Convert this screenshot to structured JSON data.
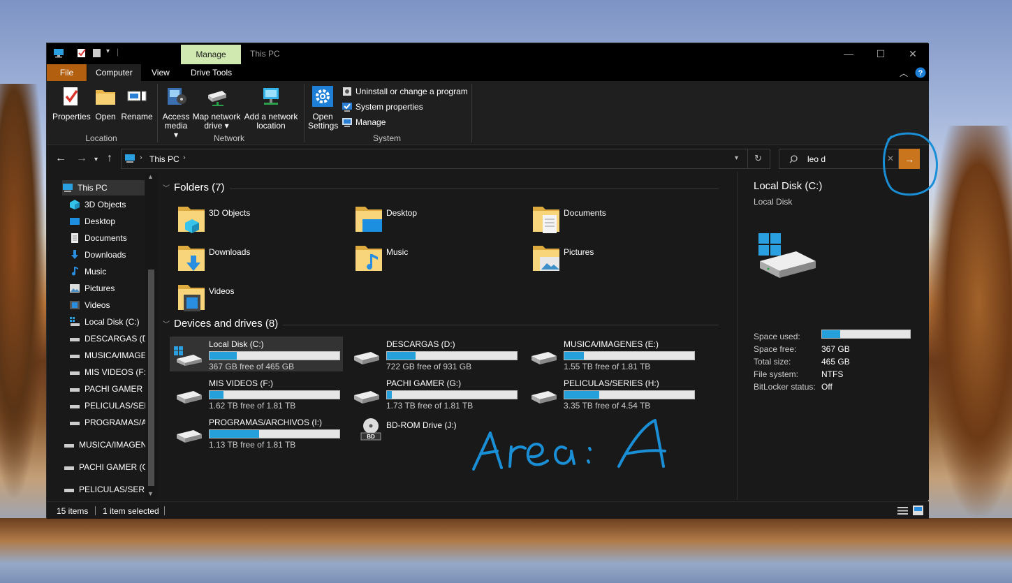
{
  "window": {
    "manage_tab": "Manage",
    "title": "This PC"
  },
  "ribbon_tabs": [
    "File",
    "Computer",
    "View",
    "Drive Tools"
  ],
  "ribbon": {
    "location": {
      "label": "Location",
      "buttons": [
        "Properties",
        "Open",
        "Rename"
      ]
    },
    "network": {
      "label": "Network",
      "access_media": [
        "Access",
        "media"
      ],
      "map_drive": [
        "Map network",
        "drive"
      ],
      "add_location": [
        "Add a network",
        "location"
      ]
    },
    "system": {
      "label": "System",
      "open_settings": [
        "Open",
        "Settings"
      ],
      "uninstall": "Uninstall or change a program",
      "system_properties": "System properties",
      "manage": "Manage"
    }
  },
  "address": {
    "path": "This PC",
    "search_value": "leo d"
  },
  "sidebar": {
    "items": [
      "This PC",
      "3D Objects",
      "Desktop",
      "Documents",
      "Downloads",
      "Music",
      "Pictures",
      "Videos",
      "Local Disk (C:)",
      "DESCARGAS (D:)",
      "MUSICA/IMAGE",
      "MIS VIDEOS (F:)",
      "PACHI GAMER (",
      "PELICULAS/SERI",
      "PROGRAMAS/AI",
      "MUSICA/IMAGEN",
      "PACHI GAMER (G:",
      "PELICULAS/SERIES"
    ]
  },
  "folders": {
    "header": "Folders (7)",
    "items": [
      "3D Objects",
      "Desktop",
      "Documents",
      "Downloads",
      "Music",
      "Pictures",
      "Videos"
    ]
  },
  "drives": {
    "header": "Devices and drives (8)",
    "items": [
      {
        "name": "Local Disk (C:)",
        "free": "367 GB free of 465 GB",
        "used_fraction": 0.21
      },
      {
        "name": "DESCARGAS (D:)",
        "free": "722 GB free of 931 GB",
        "used_fraction": 0.22
      },
      {
        "name": "MUSICA/IMAGENES (E:)",
        "free": "1.55 TB free of 1.81 TB",
        "used_fraction": 0.15
      },
      {
        "name": "MIS VIDEOS (F:)",
        "free": "1.62 TB free of 1.81 TB",
        "used_fraction": 0.11
      },
      {
        "name": "PACHI GAMER (G:)",
        "free": "1.73 TB free of 1.81 TB",
        "used_fraction": 0.04
      },
      {
        "name": "PELICULAS/SERIES (H:)",
        "free": "3.35 TB free of 4.54 TB",
        "used_fraction": 0.27
      },
      {
        "name": "PROGRAMAS/ARCHIVOS (I:)",
        "free": "1.13 TB free of 1.81 TB",
        "used_fraction": 0.38
      }
    ],
    "bd_rom": "BD-ROM Drive (J:)",
    "bd_label": "BD"
  },
  "details": {
    "title": "Local Disk (C:)",
    "subtitle": "Local Disk",
    "space_used_label": "Space used:",
    "space_used_fraction": 0.21,
    "space_free_label": "Space free:",
    "space_free": "367 GB",
    "total_size_label": "Total size:",
    "total_size": "465 GB",
    "file_system_label": "File system:",
    "file_system": "NTFS",
    "bitlocker_label": "BitLocker status:",
    "bitlocker": "Off"
  },
  "status": {
    "items_count": "15 items",
    "selected": "1 item selected"
  },
  "annotation": {
    "text": "Area: A",
    "color": "#1a8fd6"
  },
  "colors": {
    "accent": "#26a0da",
    "file_tab": "#b25f10",
    "manage_tab": "#cfe9b0",
    "go_button": "#c8751d"
  }
}
